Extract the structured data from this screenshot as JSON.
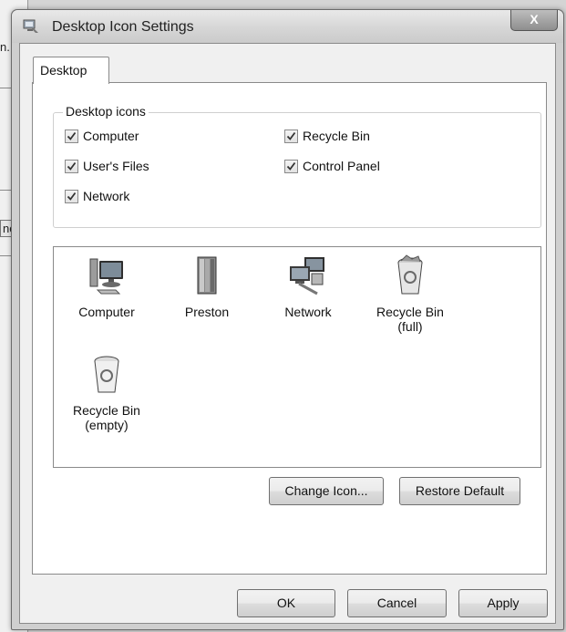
{
  "background_window": {
    "fragment_1": "n.",
    "fragment_2": "nc"
  },
  "dialog": {
    "title": "Desktop Icon Settings",
    "close_label": "X",
    "tab_label": "Desktop",
    "group_label": "Desktop icons",
    "checkboxes": [
      {
        "label": "Computer",
        "checked": true
      },
      {
        "label": "User's Files",
        "checked": true
      },
      {
        "label": "Network",
        "checked": true
      },
      {
        "label": "Recycle Bin",
        "checked": true
      },
      {
        "label": "Control Panel",
        "checked": true
      }
    ],
    "icons": [
      {
        "label": "Computer",
        "icon": "computer-icon"
      },
      {
        "label": "Preston",
        "icon": "user-folder-icon"
      },
      {
        "label": "Network",
        "icon": "network-icon"
      },
      {
        "label": "Recycle Bin\n(full)",
        "icon": "recycle-bin-full-icon"
      },
      {
        "label": "Recycle Bin\n(empty)",
        "icon": "recycle-bin-empty-icon"
      }
    ],
    "buttons": {
      "change_icon": "Change Icon...",
      "restore_default": "Restore Default",
      "ok": "OK",
      "cancel": "Cancel",
      "apply": "Apply"
    }
  }
}
